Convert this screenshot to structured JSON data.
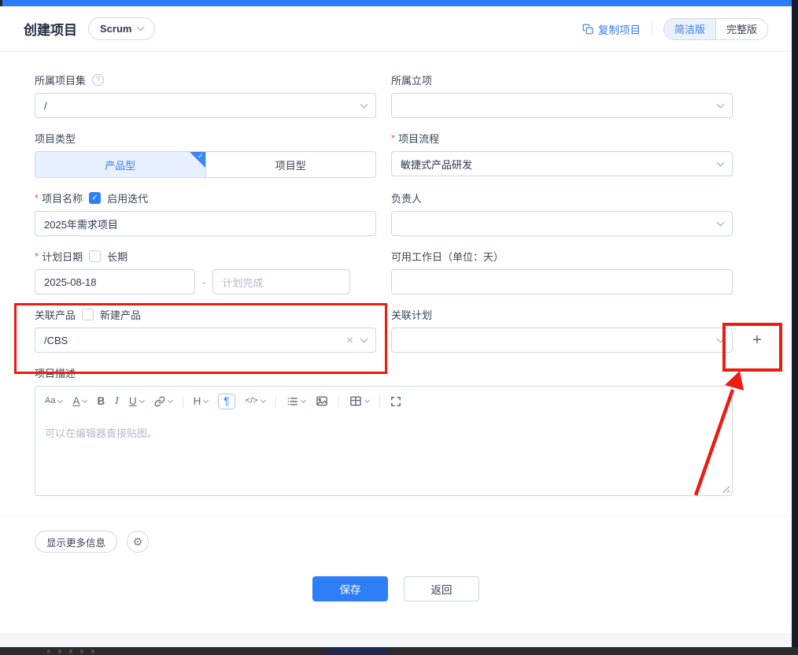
{
  "page": {
    "accent_color": "#2e7ef7",
    "annotation_color": "#ee1b10"
  },
  "icons": {
    "check": "✓",
    "gear": "⚙",
    "help": "?",
    "required": "*"
  },
  "header": {
    "title": "创建项目",
    "template_label": "Scrum",
    "copy_project_label": "复制项目",
    "view_toggle": {
      "simple": "简洁版",
      "full": "完整版",
      "selected": "简洁版"
    }
  },
  "form": {
    "project_set": {
      "label": "所属项目集",
      "value": "/"
    },
    "project_charter": {
      "label": "所属立项",
      "value": ""
    },
    "project_type": {
      "label": "项目类型",
      "option_product": "产品型",
      "option_project": "项目型",
      "selected": "产品型"
    },
    "workflow": {
      "label": "项目流程",
      "required": true,
      "value": "敏捷式产品研发"
    },
    "project_name": {
      "label": "项目名称",
      "required": true,
      "checkbox_label": "启用迭代",
      "checkbox_checked": true,
      "value": "2025年需求项目"
    },
    "owner": {
      "label": "负责人",
      "value": ""
    },
    "plan_date": {
      "label": "计划日期",
      "required": true,
      "checkbox_label": "长期",
      "checkbox_checked": false,
      "begin_value": "2025-08-18",
      "separator": "-",
      "end_placeholder": "计划完成"
    },
    "workdays": {
      "label": "可用工作日（单位：天）",
      "value": ""
    },
    "linked_product": {
      "label": "关联产品",
      "checkbox_label": "新建产品",
      "checkbox_checked": false,
      "value": "/CBS",
      "clear_glyph": "×"
    },
    "linked_plan": {
      "label": "关联计划",
      "value": "",
      "add_button_glyph": "+"
    },
    "description": {
      "label": "项目描述",
      "placeholder": "可以在编辑器直接贴图。"
    }
  },
  "editor_toolbar": [
    {
      "name": "font-size",
      "glyph": "Aa"
    },
    {
      "name": "font-color",
      "glyph": "A"
    },
    {
      "name": "bold",
      "glyph": "B"
    },
    {
      "name": "italic",
      "glyph": "I"
    },
    {
      "name": "underline",
      "glyph": "U"
    },
    {
      "name": "link",
      "glyph": ""
    },
    {
      "name": "heading",
      "glyph": "H"
    },
    {
      "name": "paragraph",
      "glyph": "¶"
    },
    {
      "name": "code",
      "glyph": "</>"
    },
    {
      "name": "list",
      "glyph": ""
    },
    {
      "name": "image",
      "glyph": ""
    },
    {
      "name": "table",
      "glyph": ""
    },
    {
      "name": "fullscreen",
      "glyph": ""
    }
  ],
  "footer": {
    "more_info_label": "显示更多信息",
    "save_label": "保存",
    "back_label": "返回"
  }
}
